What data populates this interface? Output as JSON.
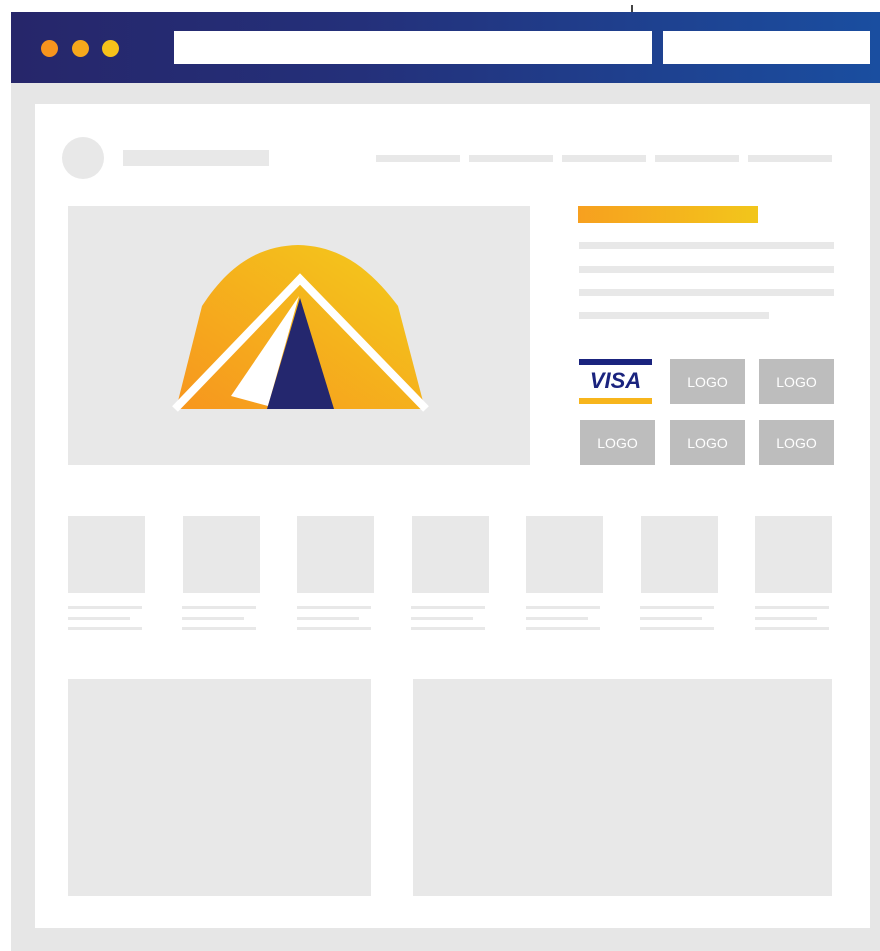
{
  "browser": {
    "window_controls": [
      "close-dot",
      "minimize-dot",
      "maximize-dot"
    ],
    "dot_colors": [
      "#f7941d",
      "#f7a81b",
      "#f7c21a"
    ],
    "address_bar_value": "",
    "search_value": ""
  },
  "payment": {
    "visa_label": "VISA",
    "logos": [
      "LOGO",
      "LOGO",
      "LOGO",
      "LOGO",
      "LOGO"
    ]
  },
  "hero": {
    "icon": "tent-icon"
  },
  "colors": {
    "accent_start": "#f7a01f",
    "accent_end": "#f2c61b",
    "brand_navy": "#1a237e",
    "placeholder_gray": "#e8e8e8",
    "logo_gray": "#bdbdbd"
  }
}
